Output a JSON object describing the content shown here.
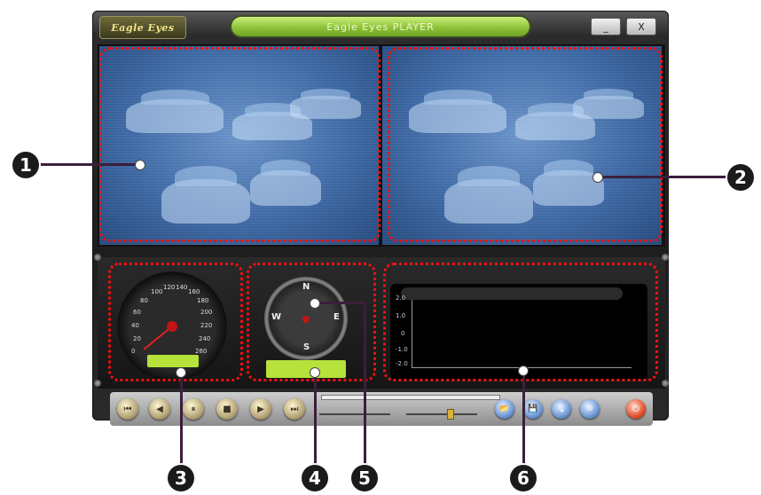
{
  "window": {
    "logo_text": "Eagle Eyes",
    "title": "Eagle Eyes PLAYER",
    "minimize_label": "_",
    "close_label": "X"
  },
  "speedometer": {
    "labels": [
      "0",
      "20",
      "40",
      "60",
      "80",
      "100",
      "120",
      "140",
      "160",
      "180",
      "200",
      "220",
      "240",
      "260"
    ]
  },
  "compass": {
    "north": "N",
    "east": "E",
    "south": "S",
    "west": "W"
  },
  "graph": {
    "ticks": [
      "2.0",
      "1.0",
      "0",
      "-1.0",
      "-2.0"
    ]
  },
  "controls": {
    "buttons": [
      {
        "name": "previous-file",
        "glyph": "⏮"
      },
      {
        "name": "step-back",
        "glyph": "◀"
      },
      {
        "name": "pause",
        "glyph": "⏸"
      },
      {
        "name": "stop",
        "glyph": "■"
      },
      {
        "name": "play",
        "glyph": "▶"
      },
      {
        "name": "next-file",
        "glyph": "⏭"
      }
    ],
    "tool_buttons": [
      {
        "name": "open-folder",
        "glyph": "📂"
      },
      {
        "name": "save",
        "glyph": "💾"
      },
      {
        "name": "snapshot",
        "glyph": "🎙"
      },
      {
        "name": "settings",
        "glyph": "⚙"
      }
    ],
    "power_glyph": "⏻"
  },
  "callouts": [
    "1",
    "2",
    "3",
    "4",
    "5",
    "6"
  ],
  "colors": {
    "accent_green": "#b6e23b",
    "annotation_red": "#e11111",
    "video_blue": "#3f6aa5"
  }
}
